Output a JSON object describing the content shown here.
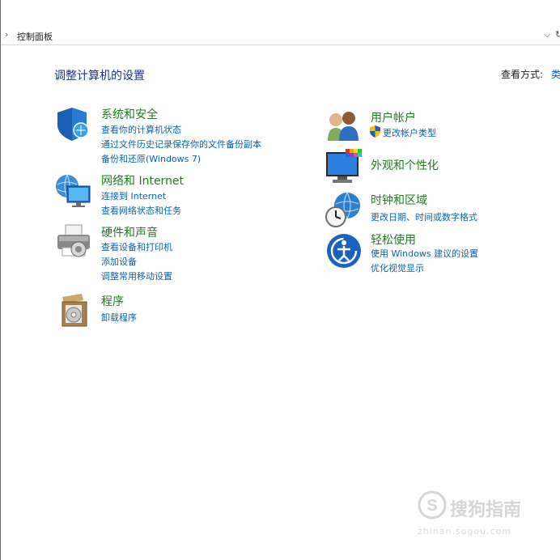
{
  "address": {
    "path": "控制面板",
    "chevron": "›",
    "dropdown": "⌵",
    "refresh": "↻"
  },
  "header": {
    "title": "调整计算机的设置",
    "view_by_label": "查看方式:",
    "view_by_value": "类别"
  },
  "left": {
    "system": {
      "title": "系统和安全",
      "links": [
        "查看你的计算机状态",
        "通过文件历史记录保存你的文件备份副本",
        "备份和还原(Windows 7)"
      ],
      "icon": "shield-icon"
    },
    "network": {
      "title": "网络和 Internet",
      "links": [
        "连接到 Internet",
        "查看网络状态和任务"
      ],
      "icon": "network-globe-icon"
    },
    "hardware": {
      "title": "硬件和声音",
      "links": [
        "查看设备和打印机",
        "添加设备",
        "调整常用移动设置"
      ],
      "icon": "printer-icon"
    },
    "programs": {
      "title": "程序",
      "links": [
        "卸载程序"
      ],
      "icon": "programs-box-icon"
    }
  },
  "right": {
    "accounts": {
      "title": "用户帐户",
      "links": [
        "更改帐户类型"
      ],
      "icon": "users-icon"
    },
    "appearance": {
      "title": "外观和个性化",
      "links": [],
      "icon": "display-palette-icon"
    },
    "clock": {
      "title": "时钟和区域",
      "links": [
        "更改日期、时间或数字格式"
      ],
      "icon": "clock-globe-icon"
    },
    "ease": {
      "title": "轻松使用",
      "links": [
        "使用 Windows 建议的设置",
        "优化视觉显示"
      ],
      "icon": "ease-of-access-icon"
    }
  },
  "watermark": {
    "text": "搜狗指南",
    "sub": "zhinan.sogou.com"
  },
  "colors": {
    "category_title": "#1f7d1f",
    "link": "#0a63b8",
    "page_title": "#1e3287"
  }
}
